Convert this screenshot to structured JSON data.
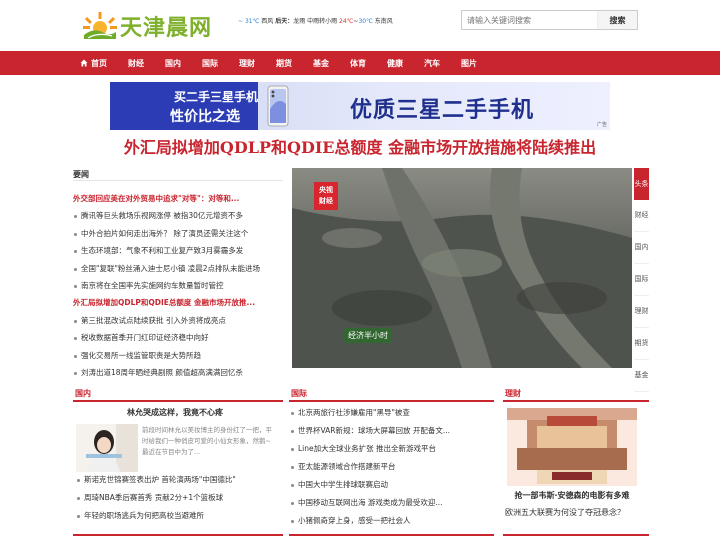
{
  "header": {
    "logo_text": "天津晨网",
    "weather": {
      "temp1": "31℃",
      "wind1": "西风",
      "day_label": "后天：",
      "condition": "龙雨 中雨转小雨",
      "temp_high": "24℃",
      "temp_low": "30℃",
      "wind2": "东南风",
      "sep1": "~",
      "sep2": "~"
    },
    "search": {
      "placeholder": "请输入关键词搜索",
      "button_label": "搜索"
    }
  },
  "nav": {
    "items": [
      {
        "label": "首页",
        "icon": "home-icon"
      },
      {
        "label": "财经"
      },
      {
        "label": "国内"
      },
      {
        "label": "国际"
      },
      {
        "label": "理财"
      },
      {
        "label": "期货"
      },
      {
        "label": "基金"
      },
      {
        "label": "体育"
      },
      {
        "label": "健康"
      },
      {
        "label": "汽车"
      },
      {
        "label": "图片"
      }
    ]
  },
  "ad": {
    "left_line1": "买二手三星手机",
    "left_line2": "性价比之选",
    "right_text": "优质三星二手手机",
    "tag": "广告"
  },
  "headline": "外汇局拟增加QDLP和QDIE总额度 金融市场开放措施将陆续推出",
  "news": {
    "label": "要闻",
    "items": [
      {
        "text": "外交部回应美在对外贸易中追求\"对等\"：对等和...",
        "highlight": true
      },
      {
        "text": "腾讯等巨头救场乐视网涨停 被指30亿元增资不多",
        "highlight": false
      },
      {
        "text": "中外合拍片如何走出海外？ 除了演员还需关注这个",
        "highlight": false
      },
      {
        "text": "生态环境部：气象不利和工业复产致3月雾霾多发",
        "highlight": false
      },
      {
        "text": "全国\"复联\"粉丝涌入迪士尼小镇 凌晨2点排队未能进场",
        "highlight": false
      },
      {
        "text": "南京将在全国率先实施网约车数量暂时管控",
        "highlight": false
      },
      {
        "text": "外汇局拟增加QDLP和QDIE总额度 金融市场开放推...",
        "highlight": true
      },
      {
        "text": "第三批混改试点陆续获批 引入外资将成亮点",
        "highlight": false
      },
      {
        "text": "税收数据首季开门红印证经济稳中向好",
        "highlight": false
      },
      {
        "text": "强化交易所一线监管职责是大势所趋",
        "highlight": false
      },
      {
        "text": "刘涛出道18周年晒经典剧照 颜值超高满满回忆杀",
        "highlight": false
      }
    ]
  },
  "main_image": {
    "logo_badge_line1": "央视",
    "logo_badge_line2": "财经",
    "caption_badge": "经济半小时"
  },
  "side_tabs": [
    {
      "label": "头条",
      "active": true
    },
    {
      "label": "财经",
      "active": false
    },
    {
      "label": "国内",
      "active": false
    },
    {
      "label": "国际",
      "active": false
    },
    {
      "label": "理财",
      "active": false
    },
    {
      "label": "期货",
      "active": false
    },
    {
      "label": "基金",
      "active": false
    }
  ],
  "sections": {
    "domestic": {
      "title": "国内",
      "feature_title": "林允哭成这样，我竟不心疼",
      "feature_desc": "前段时间林允以美妆博主的身份红了一把，平时给我们一种俏皮可爱的小仙女形象，然鹅~最近在节目中为了...",
      "items": [
        "斯诺克世锦赛签表出炉 首轮演两场\"中国德比\"",
        "周琦NBA季后赛首秀 贡献2分+1个篮板球",
        "年轻的职场逃兵为何把高校当避难所"
      ]
    },
    "international": {
      "title": "国际",
      "items": [
        "北京两旅行社涉嫌雇用\"黑导\"被查",
        "世界杯VAR新规：球场大屏幕回放 开配备文...",
        "Line加大全球业务扩张 推出全新游戏平台",
        "亚太能源领域合作搭建新平台",
        "中国大中学生排球联赛启动",
        "中国移动互联网出海 游戏类成为最受欢迎...",
        "小猪佩奇穿上身，感受一把社会人"
      ]
    },
    "finance": {
      "title": "理财",
      "image_caption": "抢一部韦斯·安德森的电影有多难",
      "sub_item": "欧洲五大联赛为何没了夺冠悬念？"
    }
  }
}
